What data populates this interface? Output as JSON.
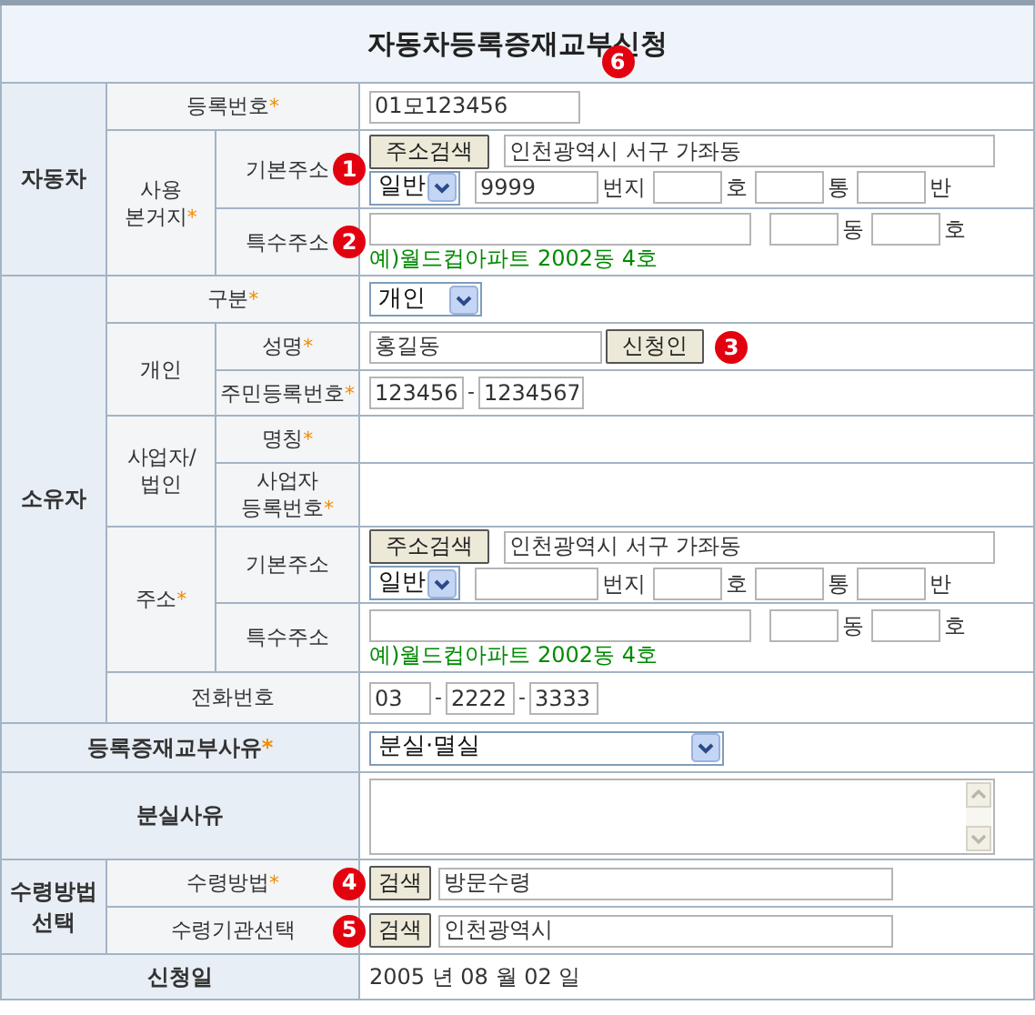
{
  "title": "자동차등록증재교부신청",
  "title_badge": "6",
  "vehicle": {
    "label": "자동차",
    "reg_no": {
      "label": "등록번호",
      "mark": "*",
      "value": "01모123456"
    },
    "location": {
      "label": "사용\n본거지",
      "mark": "*",
      "basic": {
        "label": "기본주소",
        "badge": "1",
        "search_button": "주소검색",
        "address": "인천광역시 서구 가좌동",
        "type_select": "일반",
        "fields": [
          {
            "value": "9999",
            "unit": "번지"
          },
          {
            "unit": "호"
          },
          {
            "unit": "통"
          },
          {
            "unit": "반"
          }
        ]
      },
      "special": {
        "label": "특수주소",
        "badge": "2",
        "units": [
          "동",
          "호"
        ],
        "example": "예)월드컵아파트 2002동 4호"
      }
    }
  },
  "owner": {
    "label": "소유자",
    "type": {
      "label": "구분",
      "mark": "*",
      "value": "개인"
    },
    "individual": {
      "label": "개인",
      "name": {
        "label": "성명",
        "mark": "*",
        "value": "홍길동",
        "button": "신청인",
        "badge": "3"
      },
      "rrn": {
        "label": "주민등록번호",
        "mark": "*",
        "parts": [
          "123456",
          "1234567"
        ],
        "separators": [
          "-"
        ]
      }
    },
    "business": {
      "label": "사업자/\n법인",
      "name": {
        "label": "명칭",
        "mark": "*"
      },
      "reg_no": {
        "label": "사업자\n등록번호",
        "mark": "*"
      }
    },
    "address": {
      "label": "주소",
      "mark": "*",
      "basic": {
        "label": "기본주소",
        "search_button": "주소검색",
        "address": "인천광역시 서구 가좌동",
        "type_select": "일반",
        "fields": [
          {
            "unit": "번지"
          },
          {
            "unit": "호"
          },
          {
            "unit": "통"
          },
          {
            "unit": "반"
          }
        ]
      },
      "special": {
        "label": "특수주소",
        "units": [
          "동",
          "호"
        ],
        "example": "예)월드컵아파트 2002동 4호"
      }
    },
    "phone": {
      "label": "전화번호",
      "parts": [
        "03",
        "2222",
        "3333"
      ],
      "separators": [
        "-",
        "-"
      ]
    }
  },
  "reason": {
    "label": "등록증재교부사유",
    "mark": "*",
    "value": "분실·멸실"
  },
  "loss_reason": {
    "label": "분실사유"
  },
  "receipt": {
    "label": "수령방법\n선택",
    "method": {
      "label": "수령방법",
      "mark": "*",
      "badge": "4",
      "button": "검색",
      "value": "방문수령"
    },
    "office": {
      "label": "수령기관선택",
      "badge": "5",
      "button": "검색",
      "value": "인천광역시"
    }
  },
  "application_date": {
    "label": "신청일",
    "value": "2005 년 08 월 02 일"
  }
}
